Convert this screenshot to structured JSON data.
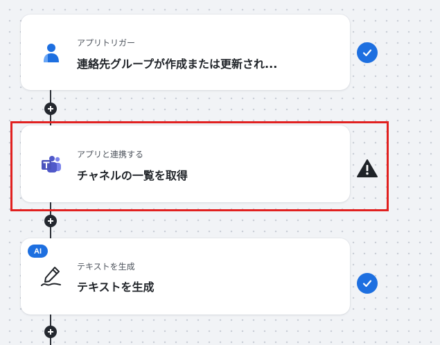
{
  "flow": {
    "steps": [
      {
        "kind": "trigger",
        "subtitle": "アプリトリガー",
        "title": "連絡先グループが作成または更新され...",
        "icon": "contact-group-person-icon",
        "status": "success"
      },
      {
        "kind": "app-action",
        "subtitle": "アプリと連携する",
        "title": "チャネルの一覧を取得",
        "icon": "microsoft-teams-icon",
        "status": "warning",
        "highlighted": true
      },
      {
        "kind": "ai-action",
        "badge": "AI",
        "subtitle": "テキストを生成",
        "title": "テキストを生成",
        "icon": "pen-write-icon",
        "status": "success"
      }
    ]
  },
  "colors": {
    "accent_blue": "#1d6fe0",
    "warning": "#1f2328",
    "highlight_red": "#e1201f",
    "teams_purple": "#5059c9"
  }
}
